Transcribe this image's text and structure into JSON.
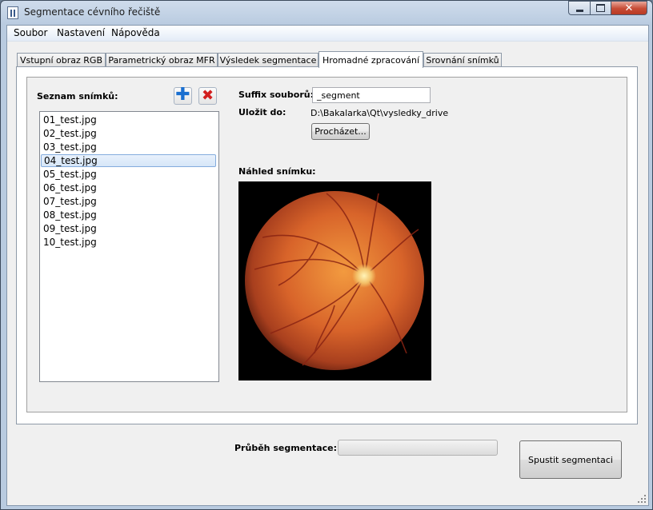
{
  "window": {
    "title": "Segmentace cévního řečiště"
  },
  "menu": [
    "Soubor",
    "Nastavení",
    "Nápověda"
  ],
  "tabs": [
    {
      "label": "Vstupní obraz RGB"
    },
    {
      "label": "Parametrický obraz MFR"
    },
    {
      "label": "Výsledek segmentace"
    },
    {
      "label": "Hromadné zpracování",
      "active": true
    },
    {
      "label": "Srovnání snímků"
    }
  ],
  "batch": {
    "list_label": "Seznam snímků:",
    "add_icon": "plus-icon",
    "remove_icon": "close-icon",
    "files": [
      "01_test.jpg",
      "02_test.jpg",
      "03_test.jpg",
      "04_test.jpg",
      "05_test.jpg",
      "06_test.jpg",
      "07_test.jpg",
      "08_test.jpg",
      "09_test.jpg",
      "10_test.jpg"
    ],
    "selected_index": 3,
    "suffix_label": "Suffix souborů:",
    "suffix_value": "_segment",
    "save_label": "Uložit do:",
    "save_path": "D:\\Bakalarka\\Qt\\vysledky_drive",
    "browse_button": "Procházet...",
    "preview_label": "Náhled snímku:"
  },
  "footer": {
    "progress_label": "Průběh segmentace:",
    "progress_value": 0,
    "run_button": "Spustit segmentaci"
  },
  "colors": {
    "accent": "#3399ff",
    "add": "#1a6fd0",
    "remove": "#d21f1f"
  }
}
